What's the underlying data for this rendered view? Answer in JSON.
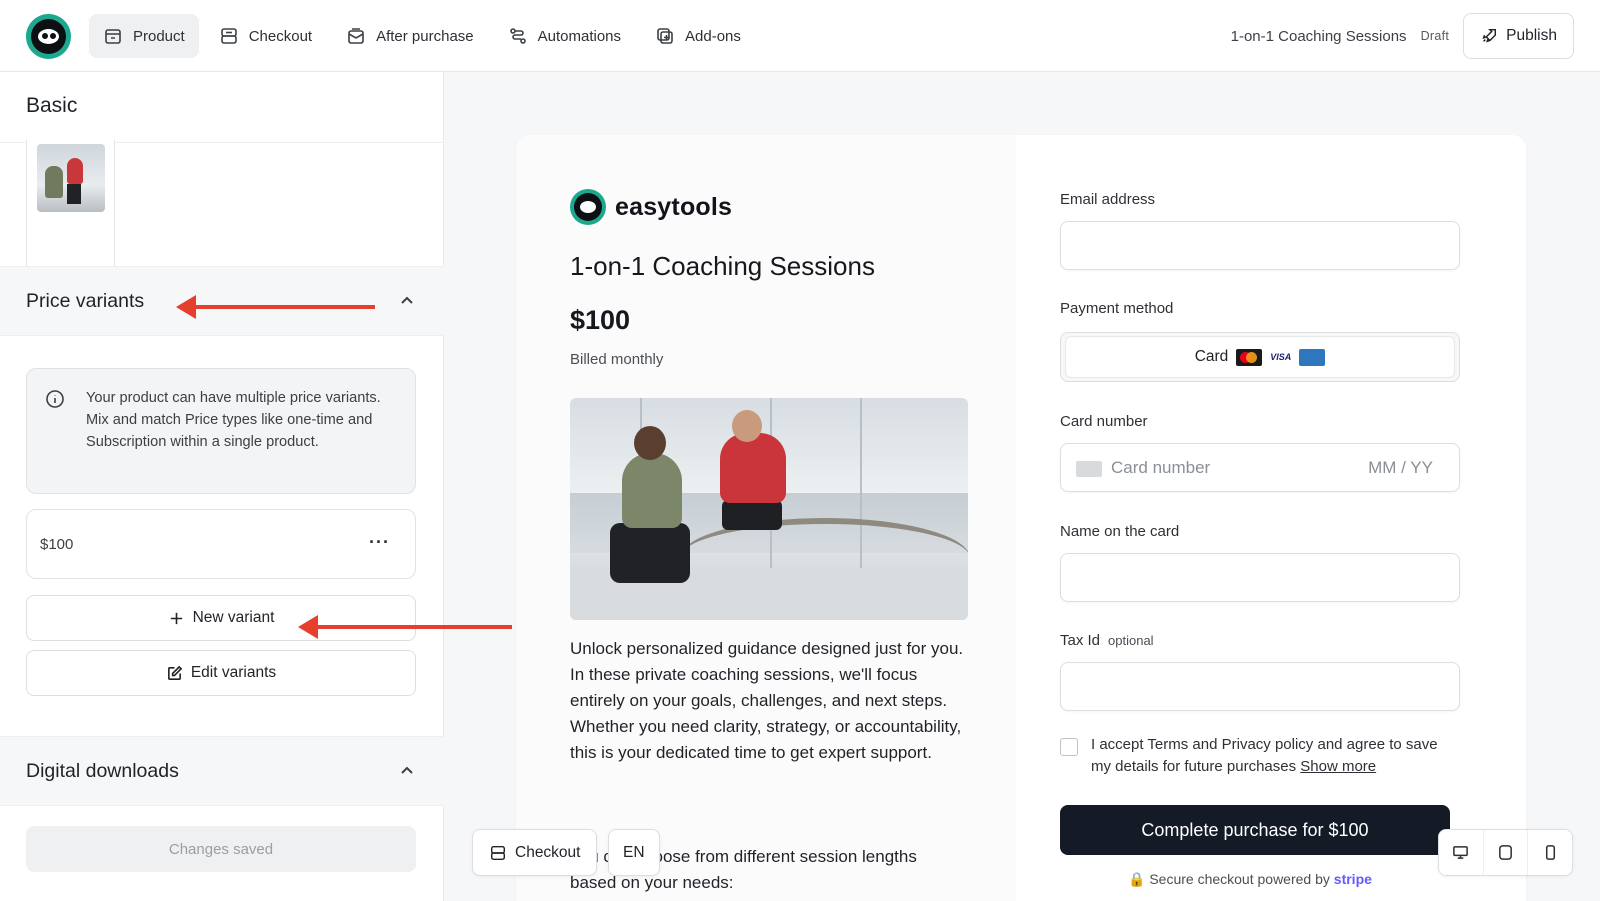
{
  "topbar": {
    "nav": [
      {
        "label": "Product",
        "icon": "box-icon",
        "active": true
      },
      {
        "label": "Checkout",
        "icon": "checkout-icon",
        "active": false
      },
      {
        "label": "After purchase",
        "icon": "mail-icon",
        "active": false
      },
      {
        "label": "Automations",
        "icon": "flow-icon",
        "active": false
      },
      {
        "label": "Add-ons",
        "icon": "addon-icon",
        "active": false
      }
    ],
    "page_name": "1-on-1 Coaching Sessions",
    "status": "Draft",
    "publish_label": "Publish"
  },
  "sidebar": {
    "basic_title": "Basic",
    "price_variants": {
      "title": "Price variants",
      "info": "Your product can have multiple price variants. Mix and match Price types like one-time and Subscription within a single product.",
      "variant_price": "$100",
      "variant_menu": "···",
      "new_variant_label": "New variant",
      "edit_variants_label": "Edit variants"
    },
    "digital_downloads_title": "Digital downloads",
    "saved_label": "Changes saved"
  },
  "preview": {
    "brand_name": "easytools",
    "product_title": "1-on-1 Coaching Sessions",
    "price": "$100",
    "billing": "Billed monthly",
    "description": "Unlock personalized guidance designed just for you. In these private coaching sessions, we'll focus entirely on your goals, challenges, and next steps. Whether you need clarity, strategy, or accountability, this is your dedicated time to get expert support.",
    "description_more": "You can choose from different session lengths based on your needs:",
    "form": {
      "email_label": "Email address",
      "payment_label": "Payment method",
      "payment_option": "Card",
      "visa_text": "VISA",
      "card_number_label": "Card number",
      "card_number_placeholder": "Card number",
      "expiry_placeholder": "MM / YY",
      "name_label": "Name on the card",
      "tax_label": "Tax Id",
      "tax_optional": "optional",
      "terms_text": "I accept Terms and Privacy policy and agree to save my details for future purchases",
      "show_more": "Show more",
      "cta_label": "Complete purchase for $100",
      "secure_text": "Secure checkout powered by",
      "stripe": "stripe"
    }
  },
  "bottom_controls": {
    "checkout_label": "Checkout",
    "language": "EN",
    "devices": [
      "desktop-icon",
      "tablet-icon",
      "mobile-icon"
    ]
  },
  "colors": {
    "accent": "#1ca88f",
    "annotation_arrow": "#e53f2e",
    "cta": "#141a26"
  }
}
